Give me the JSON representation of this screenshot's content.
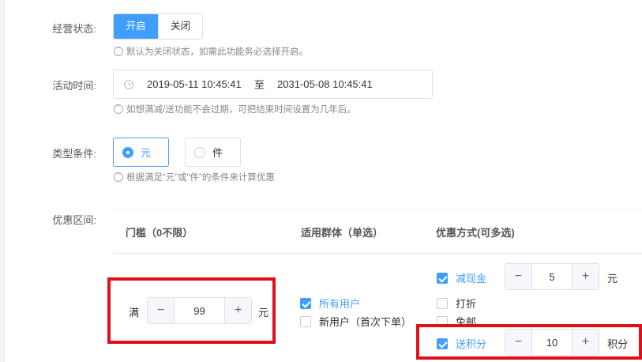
{
  "status": {
    "label": "经营状态:",
    "options": [
      "开启",
      "关闭"
    ],
    "selected": "开启",
    "tip": "默认为关闭状态，如需此功能务必选择开启。"
  },
  "activity_time": {
    "label": "活动时间:",
    "start": "2019-05-11 10:45:41",
    "separator": "至",
    "end": "2031-05-08 10:45:41",
    "tip": "如想满减/送功能不会过期，可把结束时间设置为几年后。"
  },
  "type_condition": {
    "label": "类型条件:",
    "options": [
      "元",
      "件"
    ],
    "selected": "元",
    "tip": "根据满足“元”或“件”的条件来计算优惠"
  },
  "discount_range": {
    "label": "优惠区间:",
    "columns": [
      "门槛（0不限）",
      "适用群体（单选）",
      "优惠方式(可多选)"
    ],
    "threshold": {
      "prefix": "满",
      "value": "99",
      "unit": "元",
      "minus": "−",
      "plus": "+"
    },
    "groups": [
      {
        "label": "所有用户",
        "checked": true
      },
      {
        "label": "新用户（首次下单）",
        "checked": false
      }
    ],
    "methods": {
      "cash": {
        "label": "减现金",
        "checked": true,
        "value": "5",
        "unit": "元"
      },
      "discount": {
        "label": "打折",
        "checked": false
      },
      "free_shipping": {
        "label": "免邮",
        "checked": false
      },
      "points": {
        "label": "送积分",
        "checked": true,
        "value": "10",
        "unit": "积分"
      }
    },
    "minus": "−",
    "plus": "+"
  },
  "colors": {
    "accent": "#409eff",
    "highlight": "#e0101b"
  }
}
